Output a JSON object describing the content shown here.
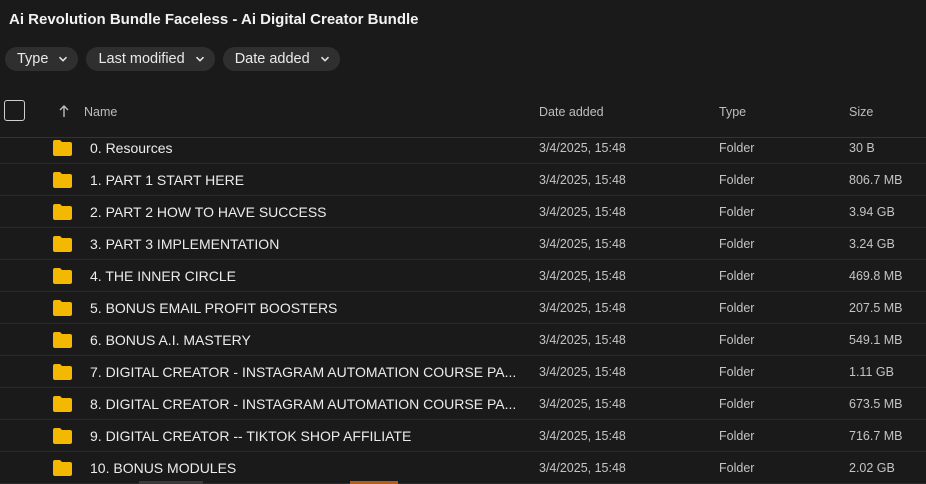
{
  "title": "Ai Revolution Bundle Faceless - Ai Digital Creator Bundle",
  "filters": [
    {
      "label": "Type",
      "icon": "chevron-down-icon"
    },
    {
      "label": "Last modified",
      "icon": "chevron-down-icon"
    },
    {
      "label": "Date added",
      "icon": "chevron-down-icon"
    }
  ],
  "columns": {
    "name": "Name",
    "date_added": "Date added",
    "type": "Type",
    "size": "Size"
  },
  "sort_icon": "arrow-up-icon",
  "folder_color": "#f5b800",
  "rows": [
    {
      "name": "0. Resources",
      "date": "3/4/2025, 15:48",
      "type": "Folder",
      "size": "30 B"
    },
    {
      "name": "1. PART 1 START HERE",
      "date": "3/4/2025, 15:48",
      "type": "Folder",
      "size": "806.7 MB"
    },
    {
      "name": "2. PART 2 HOW TO HAVE SUCCESS",
      "date": "3/4/2025, 15:48",
      "type": "Folder",
      "size": "3.94 GB"
    },
    {
      "name": "3. PART 3 IMPLEMENTATION",
      "date": "3/4/2025, 15:48",
      "type": "Folder",
      "size": "3.24 GB"
    },
    {
      "name": "4. THE INNER CIRCLE",
      "date": "3/4/2025, 15:48",
      "type": "Folder",
      "size": "469.8 MB"
    },
    {
      "name": "5. BONUS EMAIL PROFIT BOOSTERS",
      "date": "3/4/2025, 15:48",
      "type": "Folder",
      "size": "207.5 MB"
    },
    {
      "name": "6. BONUS A.I. MASTERY",
      "date": "3/4/2025, 15:48",
      "type": "Folder",
      "size": "549.1 MB"
    },
    {
      "name": "7. DIGITAL CREATOR - INSTAGRAM AUTOMATION COURSE PA...",
      "date": "3/4/2025, 15:48",
      "type": "Folder",
      "size": "1.11 GB"
    },
    {
      "name": "8. DIGITAL CREATOR - INSTAGRAM AUTOMATION COURSE PA...",
      "date": "3/4/2025, 15:48",
      "type": "Folder",
      "size": "673.5 MB"
    },
    {
      "name": "9. DIGITAL CREATOR -- TIKTOK SHOP AFFILIATE",
      "date": "3/4/2025, 15:48",
      "type": "Folder",
      "size": "716.7 MB"
    },
    {
      "name": "10. BONUS MODULES",
      "date": "3/4/2025, 15:48",
      "type": "Folder",
      "size": "2.02 GB"
    }
  ]
}
